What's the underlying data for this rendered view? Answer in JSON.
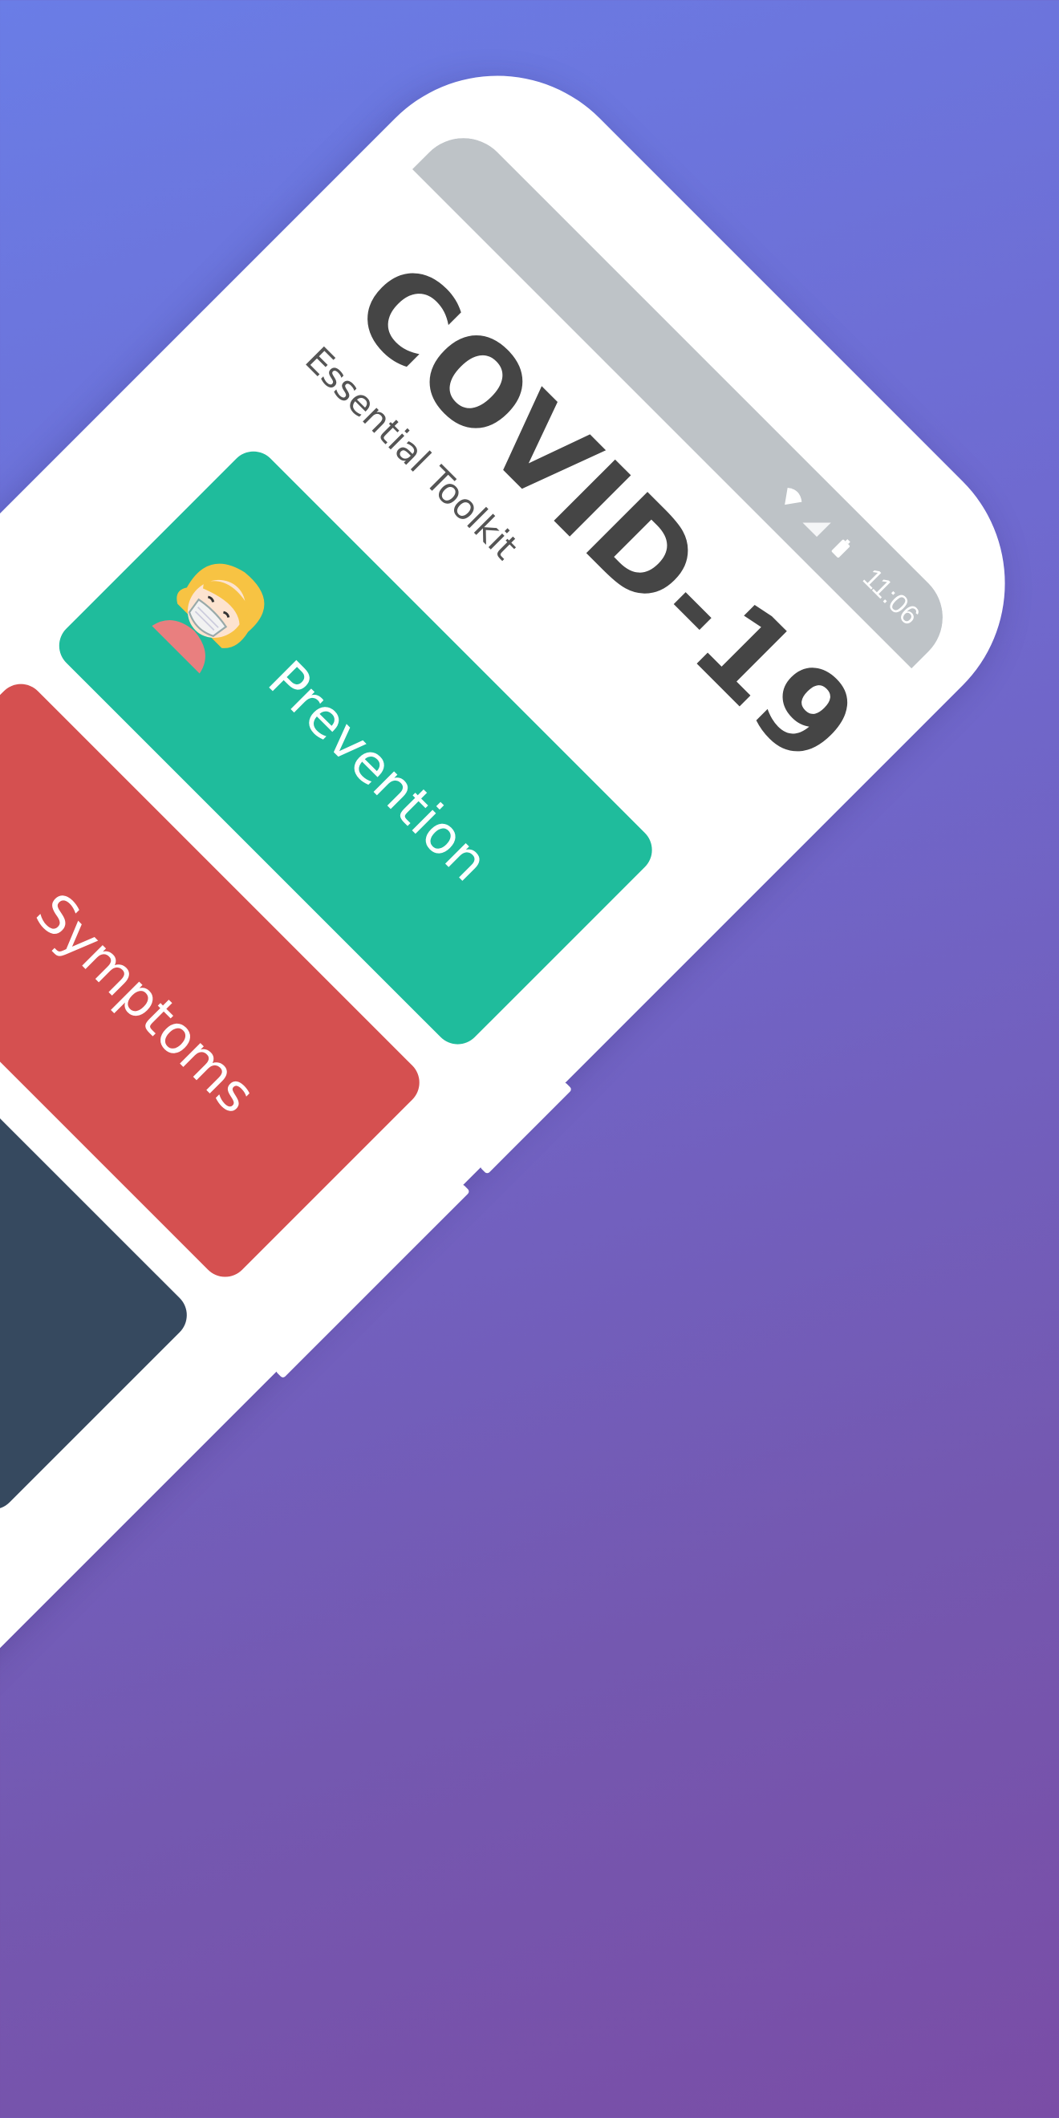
{
  "status_bar": {
    "time": "11:06",
    "icons": [
      "wifi-icon",
      "signal-icon",
      "battery-icon"
    ]
  },
  "app": {
    "title": "COVID-19",
    "subtitle": "Essential Toolkit"
  },
  "menu": {
    "prevention_label": "Prevention",
    "symptoms_label": "Symptoms",
    "card3_label": "",
    "card4_label": ""
  },
  "colors": {
    "prevention": "#1fbc9c",
    "symptoms": "#d55050",
    "dark_card": "#36495f",
    "purple_card": "#9d59b8",
    "status_bar": "#bec3c7",
    "title_text": "#454545",
    "background_top": "#6a7de6",
    "background_bottom": "#7a4da6"
  }
}
